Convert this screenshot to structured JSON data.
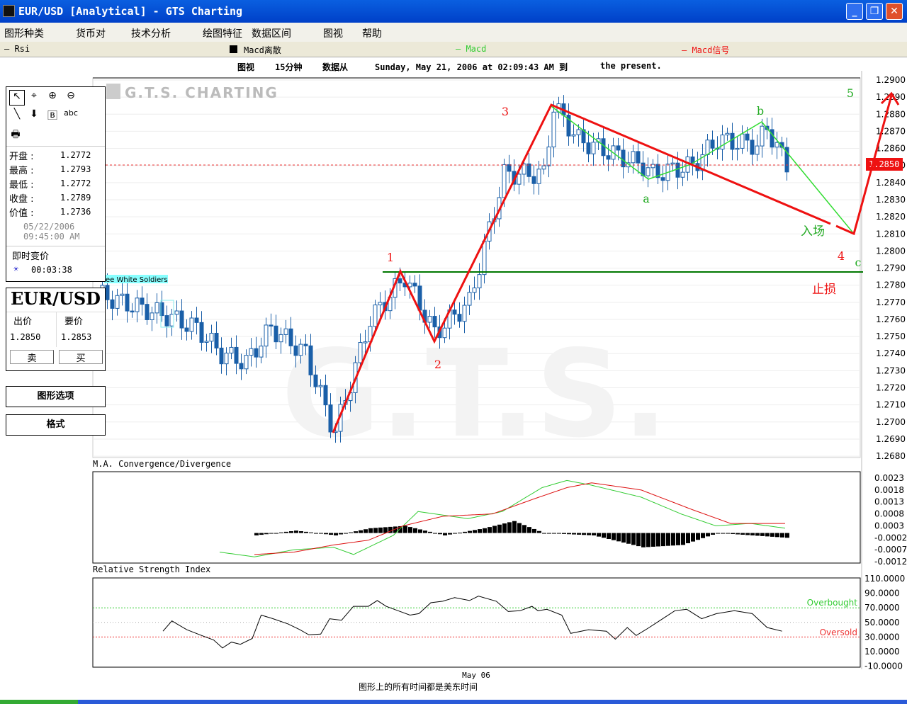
{
  "window": {
    "title": "EUR/USD [Analytical]  - GTS Charting",
    "min": "_",
    "max": "❐",
    "close": "✕"
  },
  "menu": [
    "图形种类",
    "货币对",
    "技术分析",
    "绘图特征",
    "数据区间",
    "图视",
    "帮助"
  ],
  "legend": {
    "rsi": "— Rsi",
    "macd_hist": "Macd离散",
    "macd": "— Macd",
    "macd_signal": "— Macd信号"
  },
  "infoline": {
    "view": "图视",
    "interval": "15分钟",
    "from": "数据从",
    "date": "Sunday, May 21, 2006 at 02:09:43 AM 到",
    "present": "the present."
  },
  "tools": {
    "text": "abc"
  },
  "ohlc": [
    {
      "k": "开盘 :",
      "v": "1.2772"
    },
    {
      "k": "最高 :",
      "v": "1.2793"
    },
    {
      "k": "最低 :",
      "v": "1.2772"
    },
    {
      "k": "收盘 :",
      "v": "1.2789"
    },
    {
      "k": "价值 :",
      "v": "1.2736"
    }
  ],
  "bar_date": "05/22/2006",
  "bar_time": "09:45:00 AM",
  "realtime_label": "即时变价",
  "realtime_value": "00:03:38",
  "quote": {
    "symbol": "EUR/USD",
    "bid_label": "出价",
    "ask_label": "要价",
    "bid": "1.2850",
    "ask": "1.2853",
    "sell": "卖",
    "buy": "买"
  },
  "buttons": {
    "chart_options": "图形选项",
    "format": "格式"
  },
  "watermark": {
    "logo": "G.T.S. CHARTING",
    "big": "G.T.S."
  },
  "pattern_label": "ee White Soldiers",
  "colors": {
    "up": "#ffffff",
    "down": "#1a5fa8",
    "wave": "#ee1111",
    "abc": "#33dd33",
    "support": "#007700"
  },
  "chart_data": [
    {
      "type": "candlestick",
      "title": "EUR/USD 15分钟",
      "ylim": [
        1.268,
        1.29
      ],
      "yticks": [
        "1.2900",
        "1.2890",
        "1.2880",
        "1.2870",
        "1.2860",
        "1.2850",
        "1.2840",
        "1.2830",
        "1.2820",
        "1.2810",
        "1.2800",
        "1.2790",
        "1.2780",
        "1.2770",
        "1.2760",
        "1.2750",
        "1.2740",
        "1.2730",
        "1.2720",
        "1.2710",
        "1.2700",
        "1.2690",
        "1.2680"
      ],
      "current_price": "1.2850",
      "close_waypoints": [
        [
          0,
          1.2775
        ],
        [
          5,
          1.277
        ],
        [
          14,
          1.2762
        ],
        [
          20,
          1.2755
        ],
        [
          25,
          1.274
        ],
        [
          30,
          1.2735
        ],
        [
          35,
          1.2755
        ],
        [
          42,
          1.274
        ],
        [
          47,
          1.27
        ],
        [
          48,
          1.2695
        ],
        [
          55,
          1.276
        ],
        [
          62,
          1.2785
        ],
        [
          68,
          1.2752
        ],
        [
          75,
          1.277
        ],
        [
          82,
          1.2845
        ],
        [
          90,
          1.2845
        ],
        [
          92,
          1.2885
        ],
        [
          97,
          1.2865
        ],
        [
          110,
          1.285
        ],
        [
          112,
          1.2845
        ],
        [
          120,
          1.285
        ],
        [
          125,
          1.2865
        ],
        [
          133,
          1.2862
        ],
        [
          135,
          1.2872
        ],
        [
          139,
          1.285
        ]
      ],
      "annotations": {
        "waves": [
          "1",
          "2",
          "3",
          "4",
          "5"
        ],
        "abc": [
          "a",
          "b",
          "c"
        ],
        "entry": "入场",
        "stop": "止损"
      },
      "xlabel": "May 06",
      "footnote": "图形上的所有时间都是美东时间"
    },
    {
      "type": "macd",
      "title": "M.A. Convergence/Divergence",
      "ylim": [
        -0.0012,
        0.0023
      ],
      "yticks": [
        "0.0023",
        "0.0018",
        "0.0013",
        "0.0008",
        "0.0003",
        "-0.0002",
        "-0.0007",
        "-0.0012"
      ],
      "macd_waypoints": [
        [
          25,
          -0.0008
        ],
        [
          32,
          -0.001
        ],
        [
          40,
          -0.0007
        ],
        [
          48,
          -0.0006
        ],
        [
          52,
          -0.0009
        ],
        [
          60,
          -0.0001
        ],
        [
          65,
          0.0009
        ],
        [
          75,
          0.0006
        ],
        [
          82,
          0.0009
        ],
        [
          90,
          0.0019
        ],
        [
          95,
          0.0022
        ],
        [
          100,
          0.002
        ],
        [
          110,
          0.0015
        ],
        [
          118,
          0.0008
        ],
        [
          125,
          0.0003
        ],
        [
          132,
          0.0004
        ],
        [
          139,
          0.0002
        ]
      ],
      "signal_waypoints": [
        [
          32,
          -0.0009
        ],
        [
          40,
          -0.0008
        ],
        [
          48,
          -0.0005
        ],
        [
          55,
          -0.0003
        ],
        [
          62,
          0.0003
        ],
        [
          70,
          0.0007
        ],
        [
          80,
          0.0008
        ],
        [
          88,
          0.0014
        ],
        [
          95,
          0.0019
        ],
        [
          100,
          0.0021
        ],
        [
          110,
          0.0018
        ],
        [
          120,
          0.001
        ],
        [
          128,
          0.0004
        ],
        [
          139,
          0.0004
        ]
      ],
      "hist_waypoints": [
        [
          32,
          -0.0001
        ],
        [
          40,
          0.0001
        ],
        [
          48,
          -0.0001
        ],
        [
          55,
          0.0002
        ],
        [
          62,
          0.0003
        ],
        [
          70,
          -0.0001
        ],
        [
          78,
          0.0002
        ],
        [
          84,
          0.0005
        ],
        [
          90,
          0.0
        ],
        [
          100,
          -0.0001
        ],
        [
          110,
          -0.0006
        ],
        [
          118,
          -0.0005
        ],
        [
          125,
          0.0
        ],
        [
          139,
          -0.0002
        ]
      ]
    },
    {
      "type": "line",
      "title": "Relative Strength Index",
      "ylim": [
        -10,
        110
      ],
      "yticks": [
        "110.0000",
        "90.0000",
        "70.0000",
        "50.0000",
        "30.0000",
        "10.0000",
        "-10.0000"
      ],
      "overbought": "Overbought",
      "oversold": "Oversold",
      "levels": [
        70,
        50,
        30
      ],
      "rsi_waypoints": [
        [
          14,
          38
        ],
        [
          17,
          52
        ],
        [
          22,
          40
        ],
        [
          27,
          32
        ],
        [
          31,
          26
        ],
        [
          34,
          15
        ],
        [
          37,
          23
        ],
        [
          40,
          20
        ],
        [
          44,
          28
        ],
        [
          47,
          60
        ],
        [
          51,
          55
        ],
        [
          56,
          48
        ],
        [
          60,
          40
        ],
        [
          63,
          33
        ],
        [
          67,
          34
        ],
        [
          70,
          55
        ],
        [
          74,
          53
        ],
        [
          78,
          72
        ],
        [
          83,
          72
        ],
        [
          86,
          80
        ],
        [
          89,
          72
        ],
        [
          93,
          66
        ],
        [
          97,
          60
        ],
        [
          100,
          62
        ],
        [
          104,
          77
        ],
        [
          108,
          79
        ],
        [
          112,
          84
        ],
        [
          117,
          80
        ],
        [
          120,
          86
        ],
        [
          126,
          79
        ],
        [
          130,
          65
        ],
        [
          134,
          66
        ],
        [
          138,
          72
        ],
        [
          140,
          66
        ],
        [
          143,
          68
        ],
        [
          148,
          60
        ],
        [
          151,
          35
        ],
        [
          157,
          40
        ],
        [
          163,
          38
        ],
        [
          166,
          27
        ],
        [
          170,
          43
        ],
        [
          173,
          32
        ],
        [
          177,
          42
        ],
        [
          180,
          50
        ],
        [
          186,
          66
        ],
        [
          190,
          68
        ],
        [
          195,
          55
        ],
        [
          200,
          62
        ],
        [
          206,
          66
        ],
        [
          212,
          62
        ],
        [
          217,
          43
        ],
        [
          222,
          38
        ]
      ]
    }
  ]
}
